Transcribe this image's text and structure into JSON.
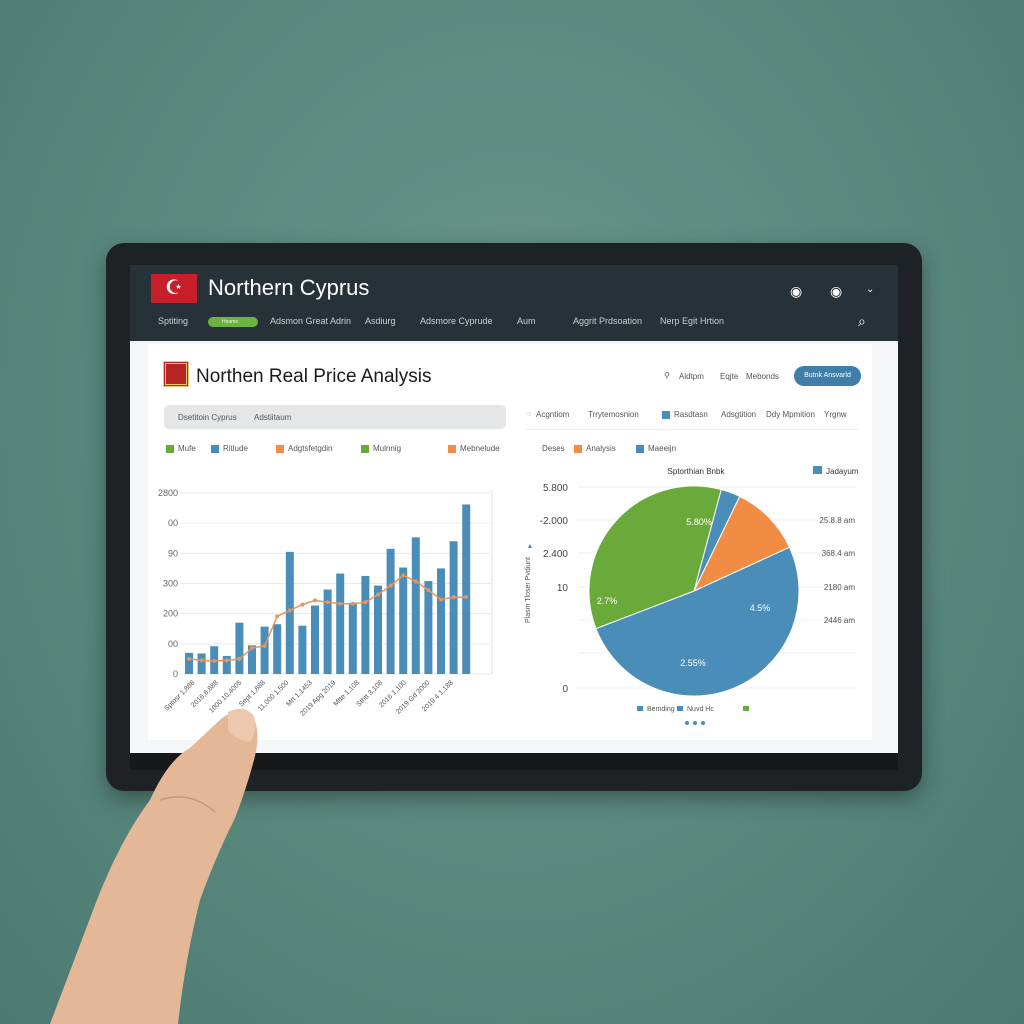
{
  "header": {
    "flag_icon": "turkish-cyprus-flag",
    "title": "Northern Cyprus",
    "nav": [
      "Sptiting",
      "Hoamn",
      "Adsmon Great Adrin",
      "Asdiurg",
      "Adsmore Cyprude",
      "Aum",
      "Aggrit Prdsoation",
      "Nerp Egit Hrtion"
    ],
    "active_nav_index": 1,
    "icons": [
      "user-icon",
      "avatar-icon",
      "chevron-down-icon",
      "search-icon"
    ]
  },
  "page": {
    "title": "Northen Real Price Analysis",
    "location_label": "Aldtpm",
    "links": [
      "Eqjte",
      "Mebonds"
    ],
    "button": "Butnk Ansvarld",
    "filter": [
      "Dsetitoin Cyprus",
      "Adstiitaum"
    ],
    "left_legend": [
      {
        "label": "Mufe",
        "color": "#6aaa3a"
      },
      {
        "label": "Ritlude",
        "color": "#4a8db8"
      },
      {
        "label": "Adgtsfetgdin",
        "color": "#f08c44"
      },
      {
        "label": "Mulnnig",
        "color": "#6aaa3a"
      },
      {
        "label": "Mebnelude",
        "color": "#f08c44"
      }
    ],
    "right_toolbar": [
      "Acgntiom",
      "Trrytemosnion",
      "Rasdtasn",
      "Adsgtition",
      "Ddy Mpmition",
      "Yrgnw"
    ],
    "right_legend": [
      {
        "label": "Deses",
        "color": ""
      },
      {
        "label": "Analysis",
        "color": "#f08c44"
      },
      {
        "label": "Maeeijn",
        "color": "#4a8db8"
      }
    ]
  },
  "chart_data": [
    {
      "type": "bar",
      "y_tick_labels": [
        "0",
        "00",
        "200",
        "300",
        "90",
        "00",
        "2800"
      ],
      "ylim": [
        0,
        600
      ],
      "grid": true,
      "x_tick_labels": [
        "Sptosr 1,888",
        "2016,6,888",
        "1000 10,4005",
        "Sept 1,888",
        "11,000 1,500",
        "Mrt 1,1453",
        "2019 Apg 2019",
        "Mtte 1,108",
        "Sthtt 3,108",
        "2016 1,100",
        "2019 Gd 2000",
        "2019 4 1,188"
      ],
      "bar_color": "#4a8db8",
      "line_color": "#e8955a",
      "bars": [
        70,
        68,
        92,
        60,
        170,
        95,
        157,
        165,
        405,
        160,
        227,
        280,
        333,
        236,
        325,
        293,
        415,
        353,
        453,
        308,
        350,
        440,
        562
      ],
      "line": [
        50,
        45,
        43,
        45,
        50,
        86,
        93,
        191,
        211,
        230,
        244,
        238,
        233,
        233,
        238,
        263,
        293,
        327,
        307,
        278,
        247,
        255,
        255
      ]
    },
    {
      "type": "pie",
      "title": "Sptorthian Bnbk",
      "legend_top": "Jadayum",
      "y_tick_labels": [
        "5.800",
        "-2.000",
        "2.400",
        "10",
        "0"
      ],
      "ylabel": "Plasm Tloser Pvdiunt",
      "right_labels": [
        "25.8.8 am",
        "368.4 am",
        "2180 am",
        "2446 am"
      ],
      "slices": [
        {
          "value": 3,
          "color": "#4a8db8",
          "label": ""
        },
        {
          "value": 11,
          "color": "#f08c44",
          "label": ""
        },
        {
          "value": 51,
          "color": "#4a8db8",
          "label": "4.5%",
          "label2": "2.55%"
        },
        {
          "value": 35,
          "color": "#6aaa3a",
          "label": "2.7%",
          "label2": "5.80%"
        }
      ],
      "legend": [
        {
          "label": "Bemding",
          "color": "#4a8db8"
        },
        {
          "label": "Nuvd Hc",
          "color": "#4a8db8"
        },
        {
          "label": "",
          "color": "#6aaa3a"
        }
      ]
    }
  ]
}
